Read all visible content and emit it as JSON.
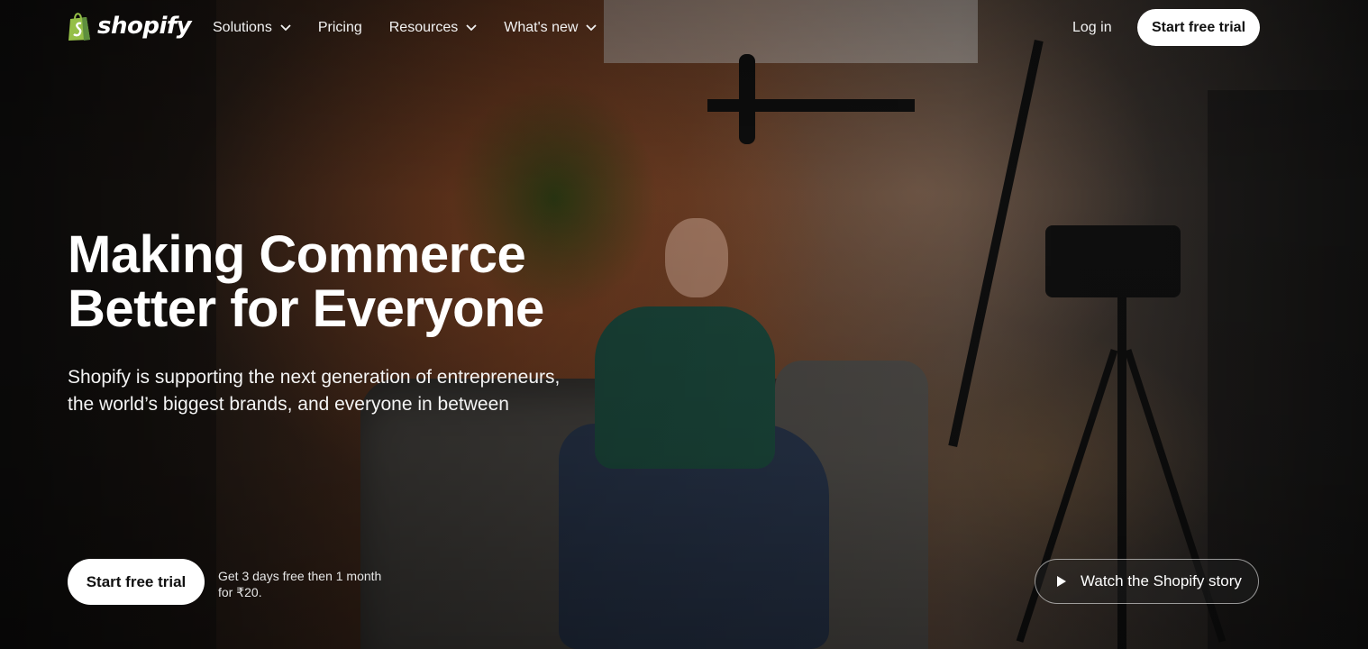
{
  "brand": {
    "logo_text": "shopify",
    "logo_icon": "shopping-bag-icon",
    "logo_color": "#95bf47"
  },
  "nav": {
    "items": [
      {
        "label": "Solutions",
        "has_dropdown": true
      },
      {
        "label": "Pricing",
        "has_dropdown": false
      },
      {
        "label": "Resources",
        "has_dropdown": true
      },
      {
        "label": "What's new",
        "has_dropdown": true
      }
    ],
    "login_label": "Log in",
    "cta_label": "Start free trial"
  },
  "hero": {
    "headline_line1": "Making Commerce",
    "headline_line2": "Better for Everyone",
    "subhead_line1": "Shopify is supporting the next generation of entrepreneurs,",
    "subhead_line2": "the world’s biggest brands, and everyone in between",
    "cta_label": "Start free trial",
    "trial_note_line1": "Get 3 days free then 1 month",
    "trial_note_line2": "for ₹20.",
    "watch_label": "Watch the Shopify story",
    "watch_icon": "play-icon"
  },
  "colors": {
    "cta_bg": "#ffffff",
    "cta_text": "#111111"
  }
}
